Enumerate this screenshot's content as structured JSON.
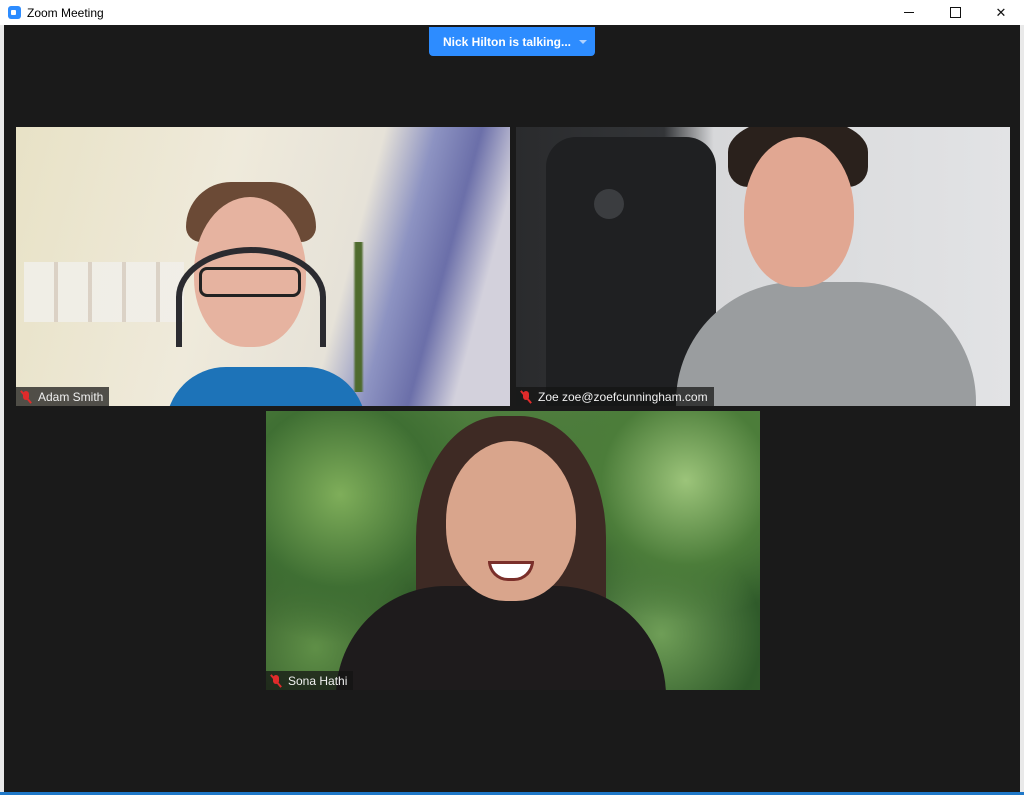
{
  "window": {
    "title": "Zoom Meeting",
    "app_icon": "zoom-camera-icon"
  },
  "controls": {
    "minimize": "minimize-icon",
    "maximize": "maximize-icon",
    "close": "close-icon"
  },
  "speaker_banner": {
    "label": "Nick Hilton is talking...",
    "color": "#2d8cff"
  },
  "participants": [
    {
      "name": "Adam Smith",
      "muted": true
    },
    {
      "name": "Zoe zoe@zoefcunningham.com",
      "muted": true
    },
    {
      "name": "Sona Hathi",
      "muted": true
    }
  ],
  "colors": {
    "meeting_background": "#1a1a1a",
    "muted_mic": "#e02b2b"
  }
}
